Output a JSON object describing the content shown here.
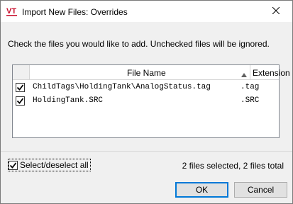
{
  "window": {
    "title": "Import New Files: Overrides",
    "app_icon": "vt-logo-icon",
    "close_icon": "close-icon"
  },
  "instructions": "Check the files you would like to add. Unchecked files will be ignored.",
  "grid": {
    "columns": [
      "",
      "File Name",
      "Extension"
    ],
    "sort": "ascending",
    "rows": [
      {
        "checked": true,
        "name": "ChildTags\\HoldingTank\\AnalogStatus.tag",
        "ext": ".tag"
      },
      {
        "checked": true,
        "name": "HoldingTank.SRC",
        "ext": ".SRC"
      }
    ]
  },
  "select_all": {
    "label": "Select/deselect all",
    "checked": true
  },
  "status": "2 files selected, 2 files total",
  "buttons": {
    "ok": "OK",
    "cancel": "Cancel"
  },
  "colors": {
    "accent": "#0078d7",
    "logo_red": "#c8102e"
  }
}
